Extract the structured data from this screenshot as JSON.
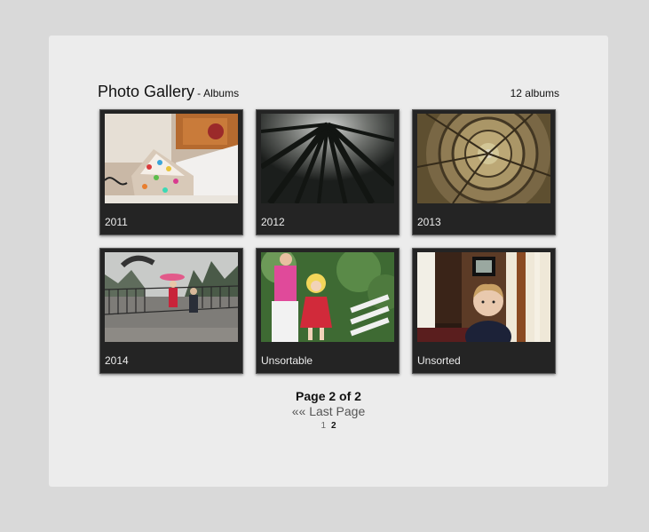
{
  "gallery": {
    "title": "Photo Gallery",
    "separator": "-",
    "subtitle": "Albums",
    "album_count": "12 albums"
  },
  "albums": [
    {
      "label": "2011",
      "thumb": "gingerbread-house-photo"
    },
    {
      "label": "2012",
      "thumb": "redwood-canopy-photo"
    },
    {
      "label": "2013",
      "thumb": "spiral-staircase-photo"
    },
    {
      "label": "2014",
      "thumb": "rainy-deck-kids-photo"
    },
    {
      "label": "Unsortable",
      "thumb": "child-in-red-dress-photo"
    },
    {
      "label": "Unsorted",
      "thumb": "toddler-indoors-photo"
    }
  ],
  "pagination": {
    "page_info": "Page 2 of 2",
    "last_page_label": "«« Last Page",
    "pages": [
      "1",
      "2"
    ],
    "current": "2"
  },
  "colors": {
    "page_bg": "#d9d9d9",
    "panel_bg": "#ececec",
    "tile_bg": "#242424"
  }
}
